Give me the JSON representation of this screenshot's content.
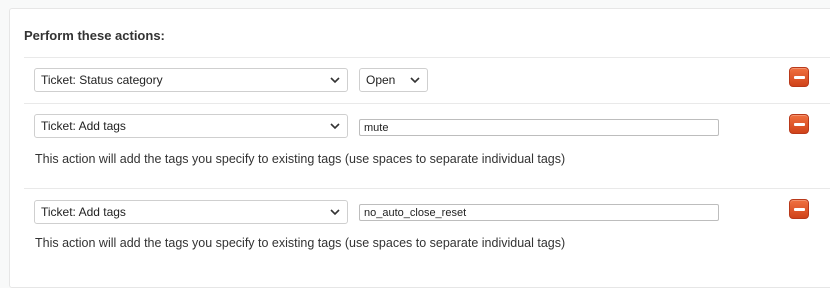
{
  "section": {
    "heading": "Perform these actions:"
  },
  "actions": [
    {
      "field": "Ticket: Status category",
      "value": "Open"
    },
    {
      "field": "Ticket: Add tags",
      "value": "mute",
      "description": "This action will add the tags you specify to existing tags (use spaces to separate individual tags)"
    },
    {
      "field": "Ticket: Add tags",
      "value": "no_auto_close_reset",
      "description": "This action will add the tags you specify to existing tags (use spaces to separate individual tags)"
    }
  ],
  "colors": {
    "remove_button": "#e05a2c",
    "panel_border": "#e6e6e6"
  },
  "icons": {
    "select_chevron": "chevron-down-icon",
    "remove": "minus-icon"
  }
}
